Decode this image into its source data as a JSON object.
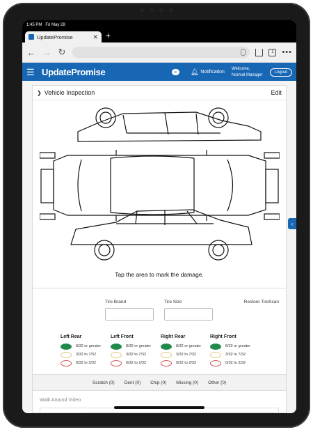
{
  "status": {
    "time": "1:45 PM",
    "date": "Fri May 28"
  },
  "browser": {
    "tab_title": "UpdatePromise",
    "tab_count": "1"
  },
  "app": {
    "brand": "UpdatePromise",
    "notification": "Notification",
    "welcome": "Welcome,",
    "user": "Normal Manager",
    "logout": "Logout"
  },
  "inspection": {
    "title": "Vehicle Inspection",
    "edit": "Edit",
    "caption": "Tap the area to mark the damage."
  },
  "tires": {
    "brand_label": "Tire Brand",
    "size_label": "Tire Size",
    "restore": "Restore TireScan",
    "columns": [
      {
        "name": "Left Rear"
      },
      {
        "name": "Left Front"
      },
      {
        "name": "Right Rear"
      },
      {
        "name": "Right Front"
      }
    ],
    "levels": [
      "8/32 or greater",
      "3/32 to 7/32",
      "0/32 to 2/32"
    ]
  },
  "damage": {
    "scratch": "Scratch (0)",
    "dent": "Dent (0)",
    "chip": "Chip (0)",
    "missing": "Missing (0)",
    "other": "Other (0)"
  },
  "walk_around": {
    "label": "Walk Around Video"
  },
  "colors": {
    "brand_blue": "#1867b4",
    "tread_green": "#1f8a4c"
  }
}
